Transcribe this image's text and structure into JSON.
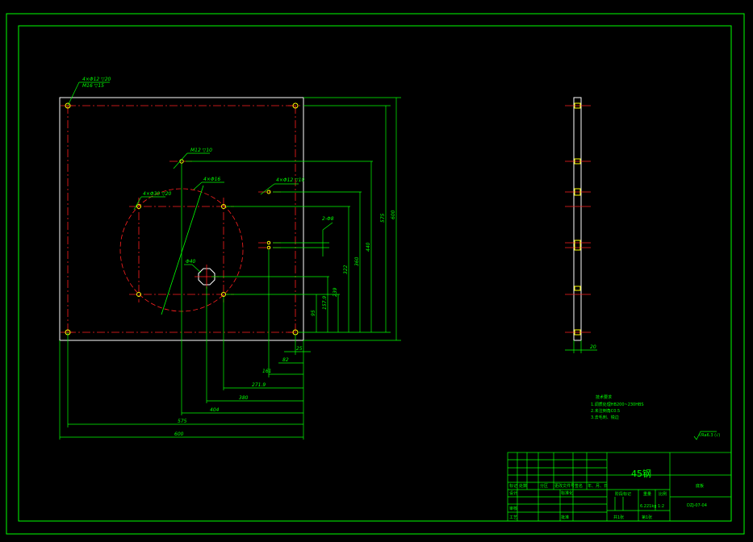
{
  "colors": {
    "outline": "#00ff00",
    "part": "#ffffff",
    "center": "#ff2020",
    "hole": "#ffff00",
    "dim": "#00ff00",
    "bg": "#000000"
  },
  "notes": {
    "hole_4": "4×Φ12 ▽20",
    "hole_4_sub": "M16 ▽15",
    "hole_m1": "M12 ▽10",
    "hole_circle": "4×Φ30 ▽20",
    "hole_m2": "4×Φ16",
    "hole_r": "4×Φ12 ▽10",
    "center_hole": "Φ40",
    "two_holes": "2-Φ8"
  },
  "dims": {
    "h600": "600",
    "h575": "575",
    "h440": "440",
    "h360": "360",
    "h322": "322",
    "h239": "239",
    "h157": "157.9",
    "h95": "95",
    "w25": "25",
    "w82": "82",
    "w161": "161",
    "w2719": "271.9",
    "w380": "380",
    "w404": "404",
    "w575": "575",
    "w600": "600",
    "side_w": "20"
  },
  "tech": {
    "title": "技术要求",
    "line1": "1.调质处理HB200~230HBS",
    "line2": "2.未注倒角C0.5",
    "line3": "3.去毛刺、锐边"
  },
  "roughness": "√Ra6.3 (√)",
  "title_block": {
    "material": "45钢",
    "part_name": "底板",
    "drawing_no": "DZJ-07-04",
    "scale": "1:2",
    "mark_label": "阶段标记",
    "weight_label": "重量",
    "scale_label": "比例",
    "weight_val": "6.221kg",
    "sheets": "共1张",
    "sheet": "第1张",
    "rev_headers": [
      "标记",
      "处数",
      "分区",
      "更改文件号",
      "签名",
      "年、月、日"
    ],
    "roles": [
      "设计",
      "审核",
      "工艺"
    ],
    "std_label": "标准化",
    "approve_label": "批准"
  }
}
